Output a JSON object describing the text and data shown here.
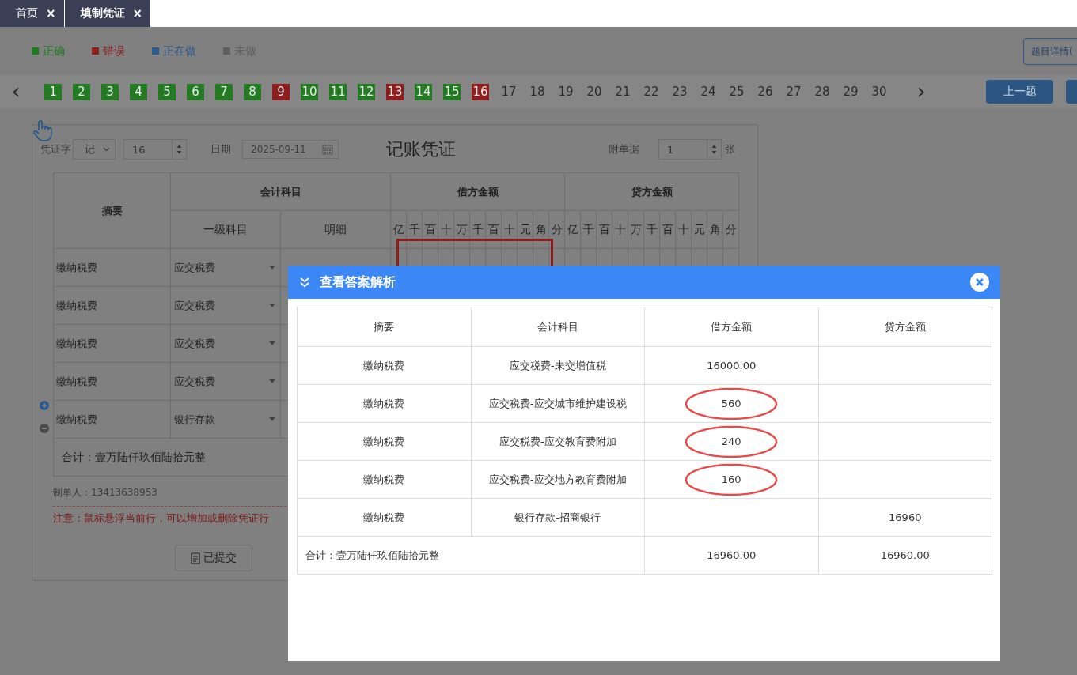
{
  "tabs": [
    {
      "label": "首页",
      "close": "×",
      "selected": false
    },
    {
      "label": "填制凭证",
      "close": "×",
      "selected": true
    }
  ],
  "legend": [
    {
      "label": "正确",
      "color": "#1f7a1f"
    },
    {
      "label": "错误",
      "color": "#8c1e1e"
    },
    {
      "label": "正在做",
      "color": "#2d5a8c"
    },
    {
      "label": "未做",
      "color": "#5e5e5e"
    }
  ],
  "detail_button": "题目详情(",
  "pager": {
    "prev": "‹",
    "next": "›",
    "items": [
      {
        "label": "1",
        "color": "#237a23"
      },
      {
        "label": "2",
        "color": "#237a23"
      },
      {
        "label": "3",
        "color": "#237a23"
      },
      {
        "label": "4",
        "color": "#237a23"
      },
      {
        "label": "5",
        "color": "#237a23"
      },
      {
        "label": "6",
        "color": "#237a23"
      },
      {
        "label": "7",
        "color": "#237a23"
      },
      {
        "label": "8",
        "color": "#237a23"
      },
      {
        "label": "9",
        "color": "#8c1e1e"
      },
      {
        "label": "10",
        "color": "#237a23"
      },
      {
        "label": "11",
        "color": "#237a23"
      },
      {
        "label": "12",
        "color": "#237a23"
      },
      {
        "label": "13",
        "color": "#8c1e1e"
      },
      {
        "label": "14",
        "color": "#237a23"
      },
      {
        "label": "15",
        "color": "#237a23"
      },
      {
        "label": "16",
        "color": "#8c1e1e"
      },
      {
        "label": "17"
      },
      {
        "label": "18"
      },
      {
        "label": "19"
      },
      {
        "label": "20"
      },
      {
        "label": "21"
      },
      {
        "label": "22"
      },
      {
        "label": "23"
      },
      {
        "label": "24"
      },
      {
        "label": "25"
      },
      {
        "label": "26"
      },
      {
        "label": "27"
      },
      {
        "label": "28"
      },
      {
        "label": "29"
      },
      {
        "label": "30"
      }
    ]
  },
  "prev_question_button": "上一题",
  "voucher": {
    "word_label": "凭证字",
    "word_value": "记",
    "number": "16",
    "date_label": "日期",
    "date": "2025-09-11",
    "title": "记账凭证",
    "attachments_label": "附单据",
    "attachments": "1",
    "attachments_unit": "张",
    "headers": {
      "summary": "摘要",
      "account": "会计科目",
      "level1": "一级科目",
      "detail": "明细",
      "debit": "借方金额",
      "credit": "贷方金额",
      "debit_digits": [
        "亿",
        "千",
        "百",
        "十",
        "万",
        "千",
        "百",
        "十",
        "元",
        "角",
        "分"
      ],
      "credit_digits": [
        "亿",
        "千",
        "百",
        "十",
        "万",
        "千",
        "百",
        "十",
        "元",
        "角",
        "分"
      ]
    },
    "error_highlight": true,
    "rows": [
      {
        "summary": "缴纳税费",
        "account": "应交税费"
      },
      {
        "summary": "缴纳税费",
        "account": "应交税费"
      },
      {
        "summary": "缴纳税费",
        "account": "应交税费"
      },
      {
        "summary": "缴纳税费",
        "account": "应交税费"
      },
      {
        "summary": "缴纳税费",
        "account": "银行存款"
      }
    ],
    "total": "合计：壹万陆仟玖佰陆拾元整",
    "maker": "制单人：13413638953",
    "note": "注意：鼠标悬浮当前行，可以增加或删除凭证行",
    "submit": "已提交"
  },
  "dialog": {
    "title": "查看答案解析",
    "columns": [
      "摘要",
      "会计科目",
      "借方金额",
      "贷方金额"
    ],
    "rows": [
      {
        "summary": "缴纳税费",
        "account": "应交税费-未交增值税",
        "debit": "16000.00",
        "circled": false
      },
      {
        "summary": "缴纳税费",
        "account": "应交税费-应交城市维护建设税",
        "debit": "560",
        "circled": true
      },
      {
        "summary": "缴纳税费",
        "account": "应交税费-应交教育费附加",
        "debit": "240",
        "circled": true
      },
      {
        "summary": "缴纳税费",
        "account": "应交税费-应交地方教育费附加",
        "debit": "160",
        "circled": true
      },
      {
        "summary": "缴纳税费",
        "account": "银行存款-招商银行",
        "credit": "16960",
        "circled": false
      }
    ],
    "total": {
      "label": "合计：壹万陆仟玖佰陆拾元整",
      "debit": "16960.00",
      "credit": "16960.00"
    }
  }
}
